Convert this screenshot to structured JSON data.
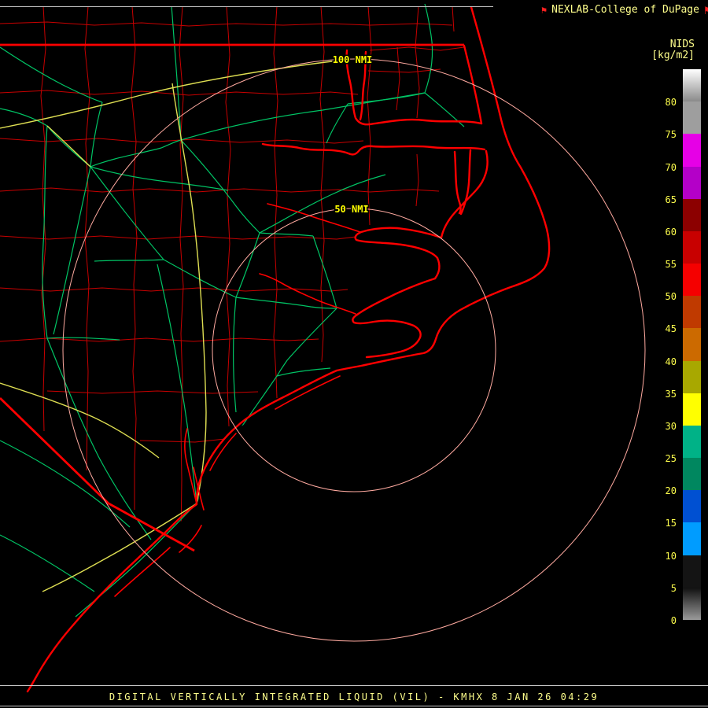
{
  "header": {
    "attribution": "NEXLAB-College of DuPage",
    "scale_title": "NIDS",
    "scale_units": "[kg/m2]"
  },
  "range_rings": {
    "outer_label": "100 NMI",
    "inner_label": "50 NMI"
  },
  "colorbar": {
    "segments": [
      {
        "value": "80",
        "css": "linear-gradient(#ffffff,#8a8a8a)"
      },
      {
        "value": "75",
        "css": "#9e9e9e"
      },
      {
        "value": "70",
        "css": "#e600e6"
      },
      {
        "value": "65",
        "css": "#b400c8"
      },
      {
        "value": "60",
        "css": "#8c0000"
      },
      {
        "value": "55",
        "css": "#c80000"
      },
      {
        "value": "50",
        "css": "#f50000"
      },
      {
        "value": "45",
        "css": "#c03a00"
      },
      {
        "value": "40",
        "css": "#cc6a00"
      },
      {
        "value": "35",
        "css": "#a8a800"
      },
      {
        "value": "30",
        "css": "#ffff00"
      },
      {
        "value": "25",
        "css": "#00b287"
      },
      {
        "value": "20",
        "css": "#00875f"
      },
      {
        "value": "15",
        "css": "#0050d2"
      },
      {
        "value": "10",
        "css": "#009cff"
      },
      {
        "value": "5",
        "css": "#141414"
      },
      {
        "value": "0",
        "css": "linear-gradient(#101010,#9a9a9a)"
      }
    ]
  },
  "footer": {
    "product_line": "DIGITAL VERTICALLY INTEGRATED LIQUID (VIL) - KMHX 8 JAN 26 04:29"
  },
  "colors": {
    "coast": "#ff0000",
    "county": "#c80000",
    "road_green": "#00c465",
    "road_yellow": "#dede52",
    "ring": "#ffaaa0",
    "label_yellow": "#ffff00",
    "text_yellow": "#ffff8c",
    "scale_label": "#ffff4d",
    "frame": "#c8c8c8"
  }
}
